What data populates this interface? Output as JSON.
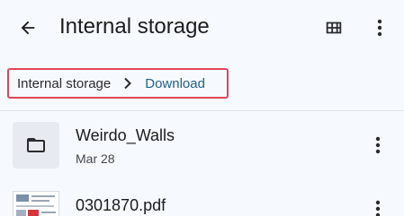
{
  "header": {
    "title": "Internal storage"
  },
  "breadcrumb": {
    "root": "Internal storage",
    "current": "Download"
  },
  "files": [
    {
      "name": "Weirdo_Walls",
      "date": "Mar 28",
      "type": "folder"
    },
    {
      "name": "0301870.pdf",
      "type": "pdf"
    }
  ],
  "icons": {
    "back": "back-arrow-icon",
    "grid": "grid-view-icon",
    "more": "more-vert-icon",
    "separator": "chevron-right-icon",
    "folder": "folder-icon"
  },
  "colors": {
    "background": "#f6f9fd",
    "highlight_border": "#e0465a",
    "current_crumb": "#1f5f87"
  }
}
